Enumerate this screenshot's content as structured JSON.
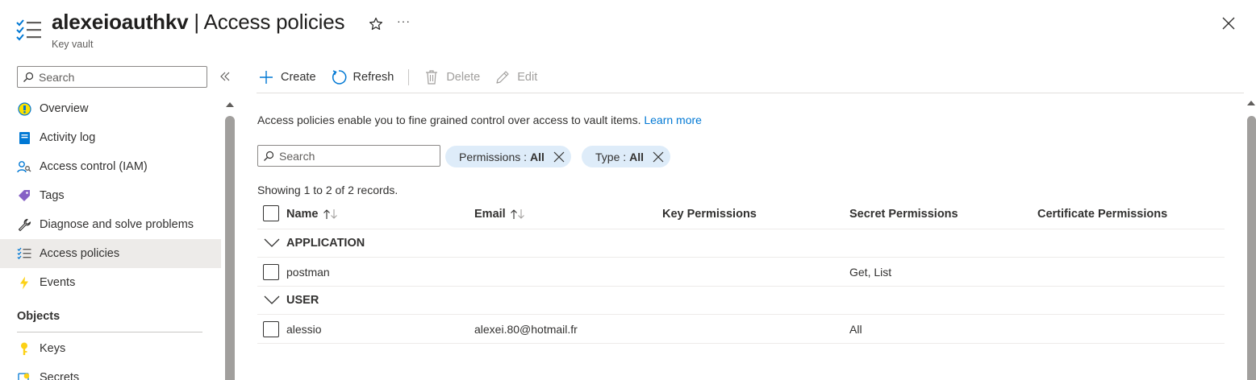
{
  "header": {
    "resource_name": "alexeioauthkv",
    "separator": " | ",
    "page_title": "Access policies",
    "subtitle": "Key vault",
    "more_label": "···"
  },
  "sidebar": {
    "search_placeholder": "Search",
    "items": [
      {
        "label": "Overview",
        "icon": "overview-icon"
      },
      {
        "label": "Activity log",
        "icon": "activity-log-icon"
      },
      {
        "label": "Access control (IAM)",
        "icon": "iam-icon"
      },
      {
        "label": "Tags",
        "icon": "tag-icon"
      },
      {
        "label": "Diagnose and solve problems",
        "icon": "wrench-icon"
      },
      {
        "label": "Access policies",
        "icon": "access-policies-icon",
        "active": true
      },
      {
        "label": "Events",
        "icon": "lightning-icon"
      }
    ],
    "section_objects": "Objects",
    "objects_items": [
      {
        "label": "Keys",
        "icon": "key-icon"
      },
      {
        "label": "Secrets",
        "icon": "secret-icon"
      }
    ]
  },
  "toolbar": {
    "create_label": "Create",
    "refresh_label": "Refresh",
    "delete_label": "Delete",
    "edit_label": "Edit"
  },
  "content": {
    "description": "Access policies enable you to fine grained control over access to vault items.",
    "learn_more": "Learn more",
    "search_placeholder": "Search",
    "filters": [
      {
        "label": "Permissions :",
        "value": "All"
      },
      {
        "label": "Type :",
        "value": "All"
      }
    ],
    "records_text": "Showing 1 to 2 of 2 records."
  },
  "table": {
    "columns": [
      "Name",
      "Email",
      "Key Permissions",
      "Secret Permissions",
      "Certificate Permissions"
    ],
    "groups": [
      {
        "name": "APPLICATION",
        "rows": [
          {
            "name": "postman",
            "email": "",
            "key": "",
            "secret": "Get, List",
            "certificate": ""
          }
        ]
      },
      {
        "name": "USER",
        "rows": [
          {
            "name": "alessio",
            "email": "alexei.80@hotmail.fr",
            "key": "",
            "secret": "All",
            "certificate": ""
          }
        ]
      }
    ]
  },
  "colors": {
    "accent": "#0078d4",
    "pill_bg": "#deecf9",
    "active_nav_bg": "#edebe9"
  }
}
